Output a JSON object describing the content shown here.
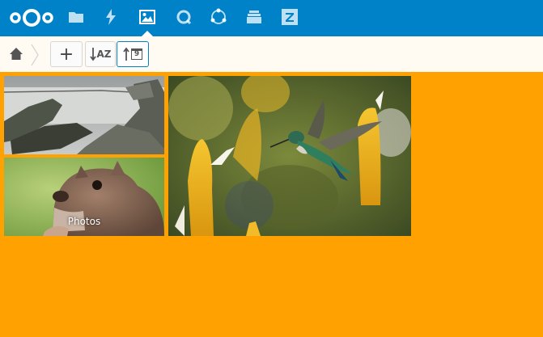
{
  "header": {
    "apps": [
      {
        "name": "files",
        "icon": "folder-icon"
      },
      {
        "name": "activity",
        "icon": "lightning-icon"
      },
      {
        "name": "gallery",
        "icon": "image-icon",
        "active": true
      },
      {
        "name": "talk",
        "icon": "search-circle-icon"
      },
      {
        "name": "circles",
        "icon": "circles-icon"
      },
      {
        "name": "deck",
        "icon": "stack-icon"
      },
      {
        "name": "zoho",
        "icon": "z-icon"
      }
    ],
    "color": "#0082c9"
  },
  "controls": {
    "add_label": "+",
    "sort_name_label": "AZ",
    "sort_date_label": "9"
  },
  "gallery": {
    "album_label": "Photos",
    "background": "#ffa100"
  }
}
